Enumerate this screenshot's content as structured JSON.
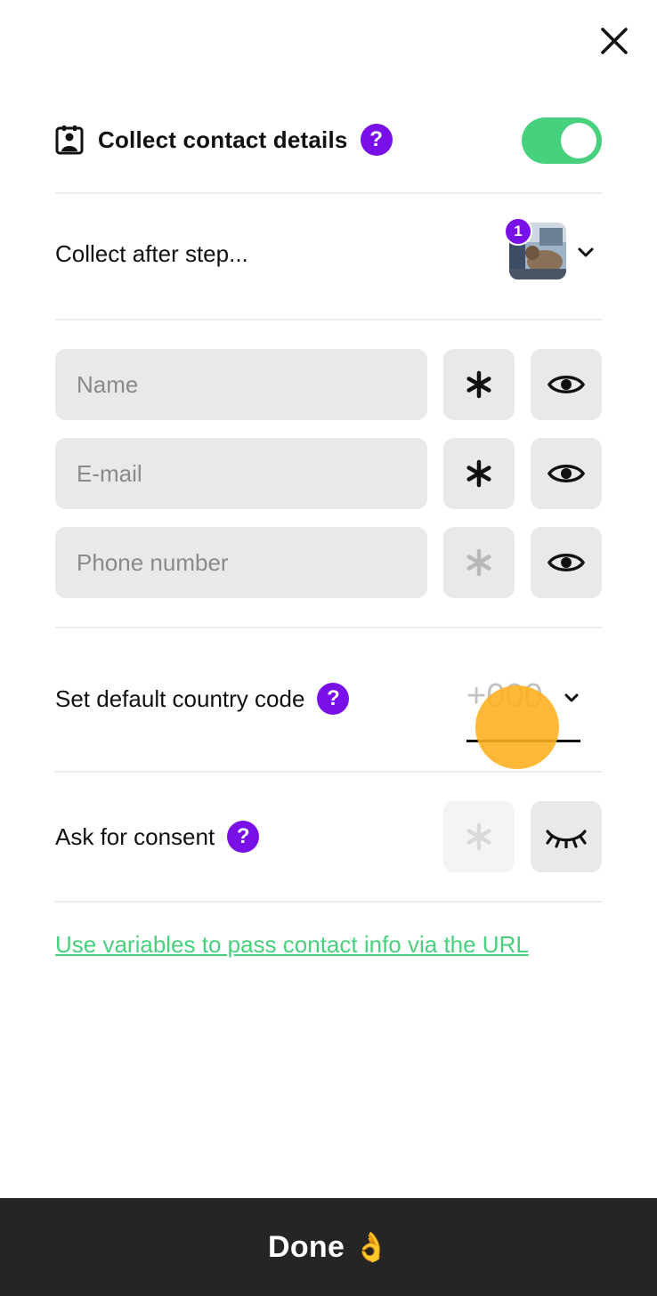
{
  "header": {
    "close_icon": "close-icon",
    "title": "Collect contact details",
    "title_icon": "contact-card-icon",
    "help_glyph": "?",
    "toggle_enabled": true,
    "toggle_color": "#47d17e"
  },
  "step": {
    "label": "Collect after step...",
    "badge": "1",
    "thumbnail_icon": "step-thumbnail-image",
    "chevron_icon": "chevron-down-icon"
  },
  "fields": [
    {
      "placeholder": "Name",
      "required": true,
      "visible": true
    },
    {
      "placeholder": "E-mail",
      "required": true,
      "visible": true
    },
    {
      "placeholder": "Phone number",
      "required": false,
      "visible": true
    }
  ],
  "country_code": {
    "label": "Set default country code",
    "placeholder": "+000",
    "chevron_icon": "chevron-down-icon"
  },
  "consent": {
    "label": "Ask for consent",
    "required": false,
    "visible": false
  },
  "link": {
    "text": "Use variables to pass contact info via the URL",
    "color": "#47d17e"
  },
  "footer": {
    "done_label": "Done",
    "done_emoji": "👌"
  },
  "colors": {
    "accent_purple": "#7a10e8",
    "accent_green": "#47d17e",
    "footer_bg": "#252525",
    "field_bg": "#e9e9e9"
  }
}
